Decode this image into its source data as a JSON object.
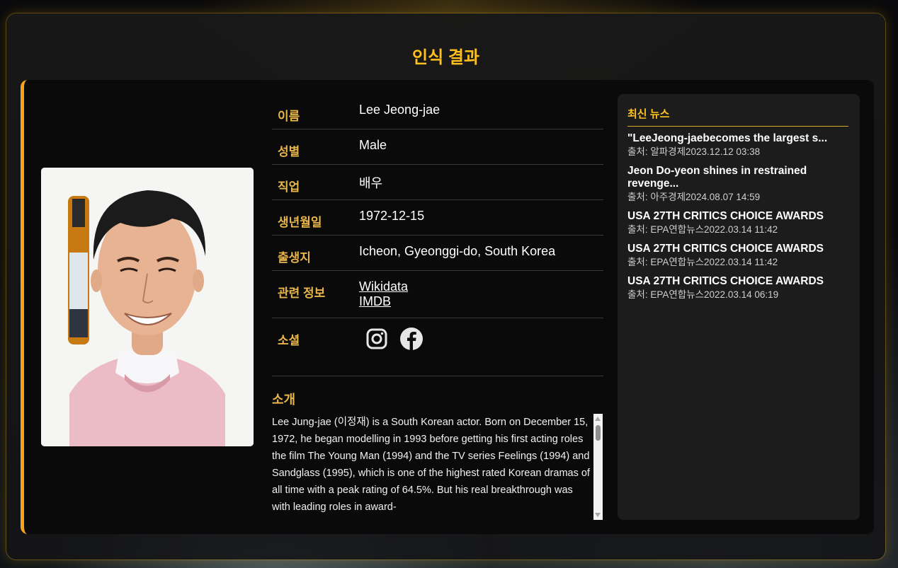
{
  "page": {
    "title": "인식 결과"
  },
  "profile": {
    "photo_icon": "person-portrait",
    "fields": {
      "name": {
        "label": "이름",
        "value": "Lee Jeong-jae"
      },
      "gender": {
        "label": "성별",
        "value": "Male"
      },
      "job": {
        "label": "직업",
        "value": "배우"
      },
      "birth_date": {
        "label": "생년월일",
        "value": "1972-12-15"
      },
      "birth_place": {
        "label": "출생지",
        "value": "Icheon, Gyeonggi-do, South Korea"
      },
      "related": {
        "label": "관련 정보",
        "links": [
          "Wikidata",
          "IMDB"
        ]
      },
      "social": {
        "label": "소셜",
        "icons": [
          "instagram-icon",
          "facebook-icon"
        ]
      }
    },
    "intro": {
      "title": "소개",
      "text": "Lee Jung-jae (이정재) is a South Korean actor. Born on December 15, 1972, he began modelling in 1993 before getting his first acting roles the film The Young Man (1994) and the TV series Feelings (1994) and Sandglass (1995), which is one of the highest rated Korean dramas of all time with a peak rating of 64.5%. But his real breakthrough was with leading roles in award-"
    }
  },
  "news": {
    "title": "최신 뉴스",
    "items": [
      {
        "headline": "\"LeeJeong-jaebecomes the largest s...",
        "source": "출처: 알파경제2023.12.12 03:38"
      },
      {
        "headline": "Jeon Do-yeon shines in restrained revenge...",
        "source": "출처: 아주경제2024.08.07 14:59"
      },
      {
        "headline": "USA 27TH CRITICS CHOICE AWARDS",
        "source": "출처: EPA연합뉴스2022.03.14 11:42"
      },
      {
        "headline": "USA 27TH CRITICS CHOICE AWARDS",
        "source": "출처: EPA연합뉴스2022.03.14 11:42"
      },
      {
        "headline": "USA 27TH CRITICS CHOICE AWARDS",
        "source": "출처: EPA연합뉴스2022.03.14 06:19"
      }
    ]
  },
  "colors": {
    "accent": "#ffbf1f",
    "label": "#e7b549",
    "card_border": "#f7a21b"
  }
}
